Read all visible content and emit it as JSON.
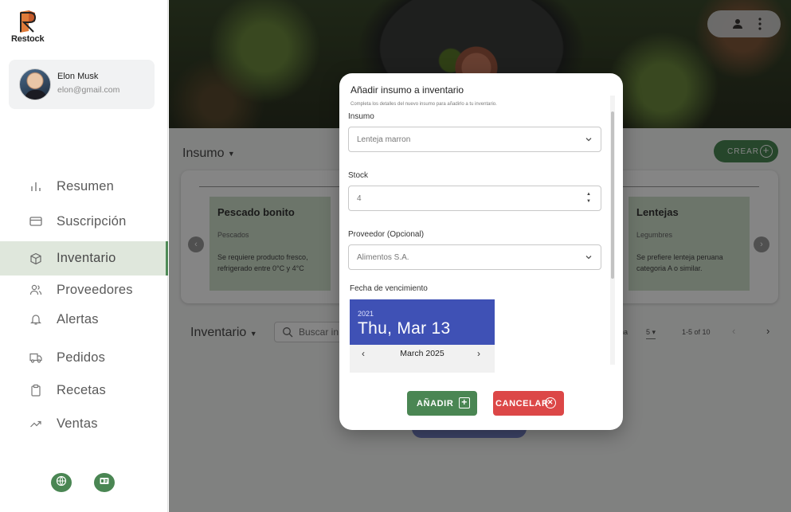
{
  "app": {
    "name": "Restock"
  },
  "user": {
    "name": "Elon Musk",
    "email": "elon@gmail.com"
  },
  "sidebar": {
    "items": [
      {
        "label": "Resumen",
        "icon": "bar-chart-icon"
      },
      {
        "label": "Suscripción",
        "icon": "credit-card-icon"
      },
      {
        "label": "Inventario",
        "icon": "box-icon",
        "active": true
      },
      {
        "label": "Proveedores",
        "icon": "users-icon"
      },
      {
        "label": "Alertas",
        "icon": "bell-icon"
      },
      {
        "label": "Pedidos",
        "icon": "truck-icon"
      },
      {
        "label": "Recetas",
        "icon": "clipboard-icon"
      },
      {
        "label": "Ventas",
        "icon": "trending-up-icon"
      }
    ],
    "footer": [
      "globe-icon",
      "id-card-icon"
    ]
  },
  "main": {
    "insumo_title": "Insumo",
    "crear_label": "CREAR",
    "cards": [
      {
        "title": "Pescado bonito",
        "category": "Pescados",
        "description": "Se requiere producto fresco, refrigerado entre 0°C y 4°C"
      },
      {
        "title": "Lentejas",
        "category": "Legumbres",
        "description": "Se prefiere lenteja peruana categoria A o similar."
      }
    ],
    "inventario_title": "Inventario",
    "search_placeholder": "Buscar in",
    "pager": {
      "rows_label": "na",
      "rows_value": "5",
      "range": "1-5 of 10"
    }
  },
  "modal": {
    "title": "Añadir insumo a inventario",
    "subtitle": "Completa los detalles del nuevo insumo para añadirlo a tu inventario.",
    "insumo_label": "Insumo",
    "insumo_value": "Lenteja marron",
    "stock_label": "Stock",
    "stock_value": "4",
    "proveedor_label": "Proveedor (Opcional)",
    "proveedor_value": "Alimentos S.A.",
    "fecha_label": "Fecha de vencimiento",
    "picker": {
      "year": "2021",
      "date": "Thu, Mar 13",
      "month": "March 2025"
    },
    "add_label": "AÑADIR",
    "cancel_label": "CANCELAR"
  },
  "colors": {
    "primary_green": "#4a8653",
    "danger_red": "#dc4747",
    "picker_blue": "#3f51b5",
    "card_green": "#cfe0cc"
  }
}
